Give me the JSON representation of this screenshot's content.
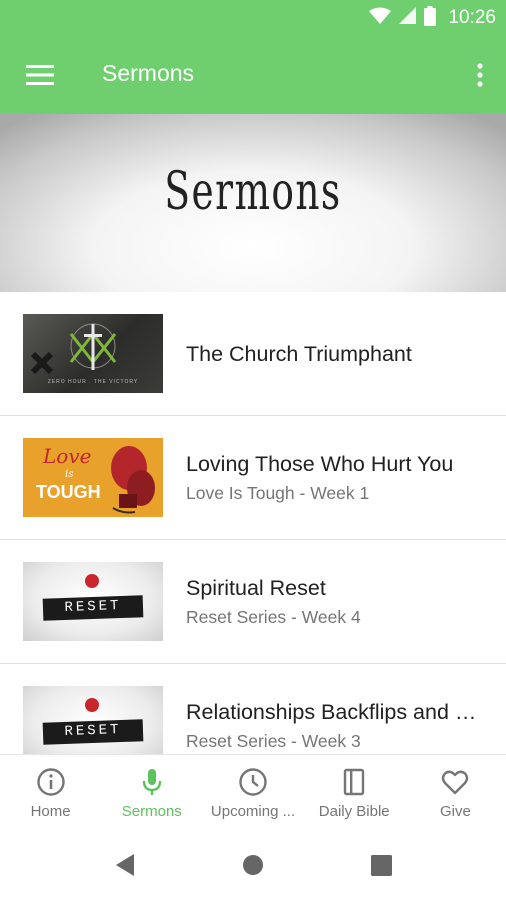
{
  "status_bar": {
    "time": "10:26",
    "icons": [
      "wifi-icon",
      "cell-signal-icon",
      "battery-icon"
    ]
  },
  "app_bar": {
    "title": "Sermons",
    "menu_icon": "hamburger-menu-icon",
    "overflow_icon": "more-vert-icon",
    "color": "#6fcf6f"
  },
  "banner": {
    "title": "Sermons"
  },
  "sermons": [
    {
      "title": "The Church Triumphant",
      "subtitle": "",
      "thumb_icon": "cross-icon",
      "thumb_caption": "ZERO HOUR . THE VICTORY"
    },
    {
      "title": "Loving Those Who Hurt You",
      "subtitle": "Love Is Tough - Week 1",
      "thumb_line1": "Love",
      "thumb_line2": "is",
      "thumb_line3": "TOUGH"
    },
    {
      "title": "Spiritual Reset",
      "subtitle": "Reset Series - Week 4",
      "thumb_text": "RESET"
    },
    {
      "title": "Relationships Backflips and Belly Flops",
      "subtitle": "Reset Series - Week 3",
      "thumb_text": "RESET"
    }
  ],
  "bottom_nav": {
    "active_color": "#5cc25c",
    "items": [
      {
        "label": "Home",
        "icon": "info-icon"
      },
      {
        "label": "Sermons",
        "icon": "microphone-icon"
      },
      {
        "label": "Upcoming ...",
        "icon": "clock-icon"
      },
      {
        "label": "Daily Bible",
        "icon": "book-icon"
      },
      {
        "label": "Give",
        "icon": "heart-icon"
      }
    ]
  },
  "system_nav": [
    "back-icon",
    "home-icon",
    "recents-icon"
  ]
}
